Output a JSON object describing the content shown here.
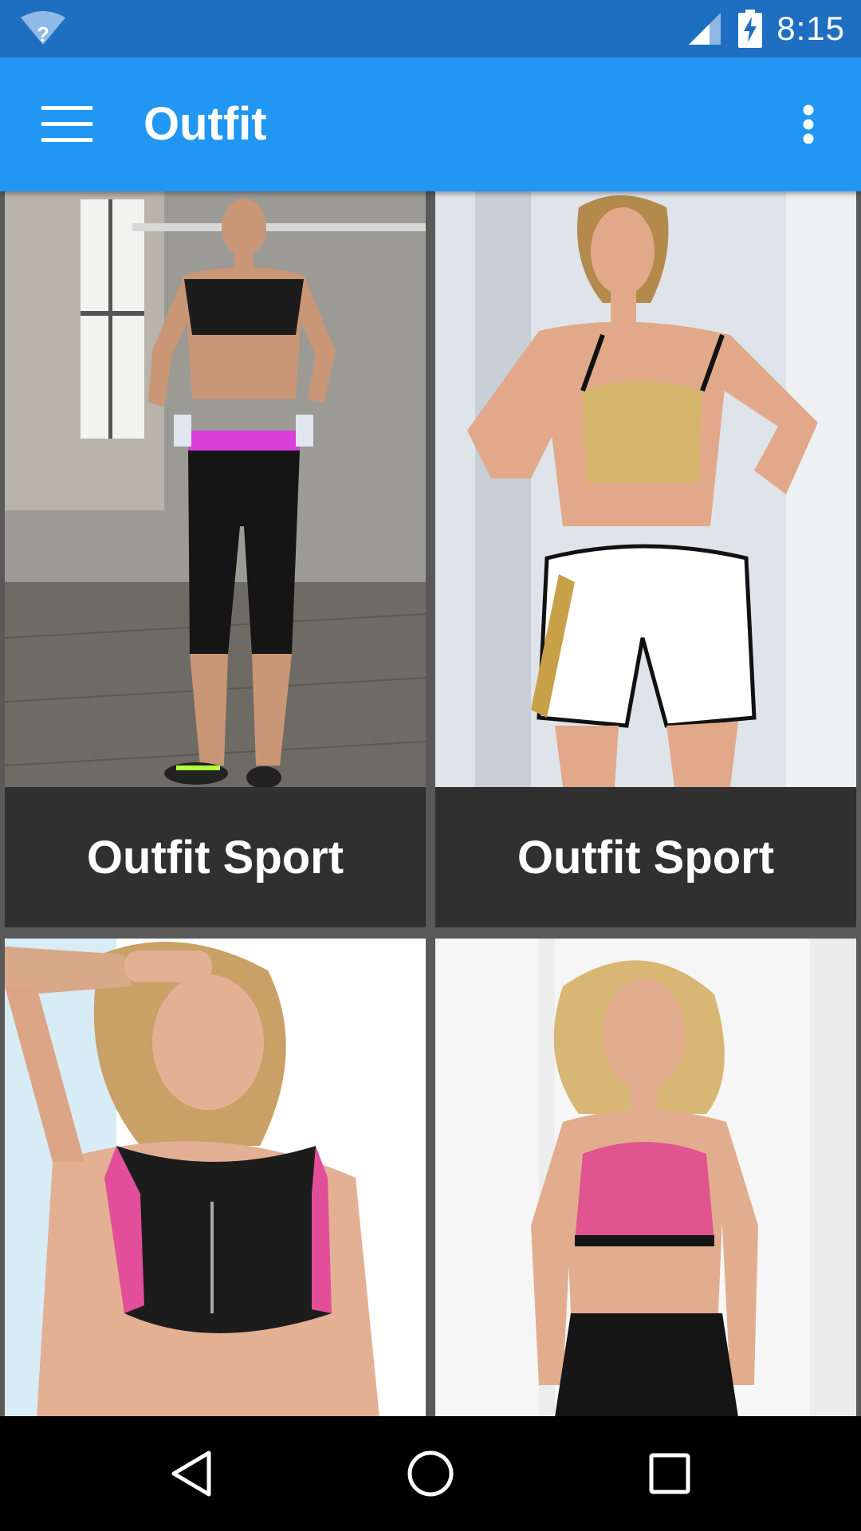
{
  "status_bar": {
    "time": "8:15",
    "wifi_icon": "wifi-unknown-icon",
    "signal_icon": "cell-signal-icon",
    "battery_icon": "battery-charging-icon",
    "wifi_badge": "?"
  },
  "app_bar": {
    "title": "Outfit",
    "menu_icon": "hamburger-menu-icon",
    "overflow_icon": "more-vert-icon"
  },
  "grid": {
    "items": [
      {
        "caption": "Outfit Sport",
        "image": "woman in black sports bra and leggings in gym"
      },
      {
        "caption": "Outfit Sport",
        "image": "woman in gold sports bra and white shorts"
      },
      {
        "caption": "",
        "image": "woman in black and pink zip sports bra"
      },
      {
        "caption": "",
        "image": "woman in pink sports bra and black leggings"
      }
    ]
  },
  "nav_bar": {
    "back_icon": "back-triangle-icon",
    "home_icon": "home-circle-icon",
    "recents_icon": "recents-square-icon"
  },
  "colors": {
    "status_bar": "#1E6FC2",
    "app_bar": "#2196F3",
    "caption_bg": "#303030",
    "grid_bg": "#595959",
    "nav_bar": "#000000"
  }
}
